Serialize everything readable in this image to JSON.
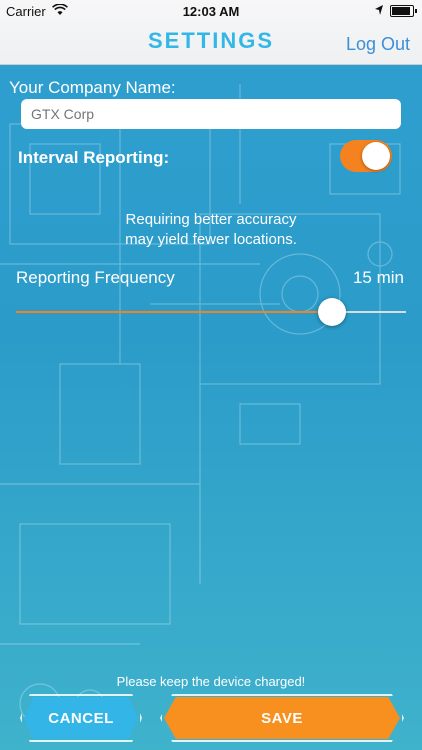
{
  "status_bar": {
    "carrier": "Carrier",
    "time": "12:03 AM",
    "icons": [
      "wifi-icon",
      "location-arrow-icon",
      "battery-icon"
    ],
    "battery_fraction": 1.0
  },
  "nav": {
    "title": "SETTINGS",
    "logout_label": "Log Out"
  },
  "form": {
    "company_label": "Your Company Name:",
    "company_placeholder": "GTX Corp",
    "company_value": "",
    "interval_label": "Interval Reporting:",
    "interval_on": true,
    "accuracy_note_line1": "Requiring better accuracy",
    "accuracy_note_line2": "may yield fewer locations.",
    "frequency_label": "Reporting Frequency",
    "frequency_value": "15 min",
    "frequency_slider_fraction": 0.81
  },
  "footer": {
    "note": "Please keep the device charged!",
    "cancel_label": "CANCEL",
    "save_label": "SAVE"
  },
  "colors": {
    "accent_orange": "#f58220",
    "accent_blue": "#33b5e8",
    "title_blue": "#33b7e6",
    "link_blue": "#3d8fd7",
    "background_blue": "#2f9fd0"
  }
}
